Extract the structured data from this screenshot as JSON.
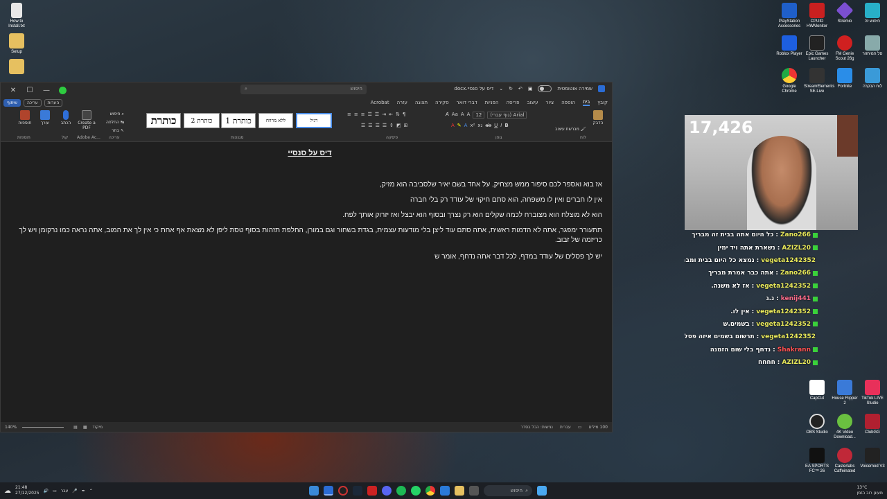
{
  "desktop_left": [
    {
      "label": "How to Install.txt",
      "icon": "text-file-icon",
      "color": "#e8e8e8"
    },
    {
      "label": "Setup",
      "icon": "folder-icon",
      "color": "#e6c060"
    },
    {
      "label": "",
      "icon": "folder-icon",
      "color": "#e6c060"
    }
  ],
  "desktop_right": [
    {
      "label": "PlayStation Accessories",
      "icon": "playstation-icon",
      "color": "#1f5fc9"
    },
    {
      "label": "CPUID HWMonitor",
      "icon": "hwmonitor-icon",
      "color": "#c92020"
    },
    {
      "label": "Stremio",
      "icon": "stremio-icon",
      "color": "#7b4fd1"
    },
    {
      "label": "חיפוש זה",
      "icon": "app-icon",
      "color": "#28b0c8"
    },
    {
      "label": "Roblox Player",
      "icon": "roblox-icon",
      "color": "#1d5fe0"
    },
    {
      "label": "Epic Games Launcher",
      "icon": "epic-icon",
      "color": "#222222"
    },
    {
      "label": "FM Genie Scout 26g",
      "icon": "fm-genie-icon",
      "color": "#d02020"
    },
    {
      "label": "סל המיחזור",
      "icon": "recycle-bin-icon",
      "color": "#8aa"
    },
    {
      "label": "Google Chrome",
      "icon": "chrome-icon",
      "color": "#e0a020"
    },
    {
      "label": "StreamElements SE.Live",
      "icon": "se-live-icon",
      "color": "#333"
    },
    {
      "label": "Fortnite",
      "icon": "fortnite-icon",
      "color": "#2a8de8"
    },
    {
      "label": "לוח הבקרה",
      "icon": "control-panel-icon",
      "color": "#3a9ad8"
    }
  ],
  "desktop_right_lower": [
    {
      "label": "CapCut",
      "icon": "capcut-icon",
      "color": "#fff"
    },
    {
      "label": "House Flipper 2",
      "icon": "house-flipper-icon",
      "color": "#3a7ad8"
    },
    {
      "label": "TikTok LIVE Studio",
      "icon": "tiktok-icon",
      "color": "#e8305a"
    },
    {
      "label": "OBS Studio",
      "icon": "obs-icon",
      "color": "#222"
    },
    {
      "label": "4K Video Download...",
      "icon": "4k-video-icon",
      "color": "#6ac040"
    },
    {
      "label": "ClubGG",
      "icon": "clubgg-icon",
      "color": "#b02030"
    },
    {
      "label": "EA SPORTS FC™ 26",
      "icon": "ea-fc-icon",
      "color": "#111"
    },
    {
      "label": "Casterlabs Caffeinated",
      "icon": "casterlabs-icon",
      "color": "#c02838"
    },
    {
      "label": "Voicemod V3",
      "icon": "voicemod-icon",
      "color": "#222"
    }
  ],
  "word": {
    "search_placeholder": "חיפוש",
    "doc_title": "דיס על סנסיי.docx",
    "autosave": "שמירה אוטומטית",
    "tabs": [
      "קובץ",
      "בית",
      "הוספה",
      "ציור",
      "עיצוב",
      "פריסה",
      "הפניות",
      "דברי דואר",
      "סקירה",
      "תצוגה",
      "עזרה",
      "Acrobat"
    ],
    "active_tab": "בית",
    "pill_editing": "עריכה",
    "pill_share": "שיתוף",
    "pill_comments": "הערות",
    "styles": [
      "רגיל",
      "ללא מרווח",
      "כותרת 1",
      "כותרת 2",
      "כותרת"
    ],
    "font_name": "Arial (גוף עברי)",
    "font_size": "12",
    "group_labels": {
      "clipboard": "לוח",
      "font": "גופן",
      "paragraph": "פיסקה",
      "styles": "סגנונות",
      "editing": "עריכה",
      "voice": "קול",
      "addins": "תוספות",
      "adobe": "Adobe Ac..."
    },
    "ribbon_buttons": {
      "paste": "הדבק",
      "format_painter": "מברשת עיצוב",
      "find": "חיפוש",
      "replace": "החלפה",
      "select": "בחר",
      "dictate": "הכתב",
      "editor": "עורך",
      "create_pdf": "Create a PDF",
      "addins": "תוספות"
    },
    "document": {
      "heading": "דיס על סנסיי",
      "paragraphs": [
        "אז בוא ואספר לכם סיפור ממש מצחיק, על אחד בשם יאיר שלסביבה הוא מזיק,",
        "אין לו חברים ואין לו משפחה, הוא סתם חיקוי של עודד רק בלי חברה",
        "הוא לא מוצלח הוא מצוברח לכמה שקלים הוא רק נצרך ובסוף הוא יבצל ואז יזרוק אותך לפח.",
        "תתעורר ימפגר, אתה לא הדמות ראשית, אתה סתם עוד ליצן בלי מודעות עצמית, בגדת בשחור וגם במורן, החלפת תזהות בסוף טסת ליפן לא מצאת אף אחת כי אין לך את המוב, אתה נראה כמו נרקומן ויש לך כריזמה של זבוב.",
        "יש לך פסלים של עודד במדף, לכל דבר אתה נדחף, אומר ש"
      ]
    },
    "status": {
      "words": "100 מילים",
      "language": "עברית",
      "accessibility": "נגישות: הכל בסדר",
      "focus": "מיקוד",
      "zoom": "140%"
    }
  },
  "stream": {
    "viewer_count": "17,426",
    "chat": [
      {
        "user": "Zano266",
        "text": "כל היום אתה בבית זה מבריך"
      },
      {
        "user": "AZIZL20",
        "text": "נשארת אתה ויד ימין"
      },
      {
        "user": "vegeta1242352",
        "text": "נמצא כל היום בבית ומבריך"
      },
      {
        "user": "Zano266",
        "text": "אתה כבר אמרת מבריך"
      },
      {
        "user": "vegeta1242352",
        "text": "אז לא משנה."
      },
      {
        "user": "kenij441",
        "text": "נ.ג"
      },
      {
        "user": "vegeta1242352",
        "text": "אין לו."
      },
      {
        "user": "vegeta1242352",
        "text": "בשמים.ש"
      },
      {
        "user": "vegeta1242352",
        "text": "תרשום בשמים איזה פסלים?"
      },
      {
        "user": "Shakrann",
        "text": "נדחף בלי שום הזמנה"
      },
      {
        "user": "AZIZL20",
        "text": "חחחח"
      }
    ]
  },
  "taskbar": {
    "search": "חיפוש",
    "lang": "עבר",
    "time": "21:48",
    "date": "27/12/2025",
    "weather": "13°C",
    "weather_desc": "מעונן רוב הזמן"
  },
  "colors": {
    "accent": "#4a8de8",
    "word_blue": "#2b6cd4",
    "chat_user": "#e8e85a"
  }
}
